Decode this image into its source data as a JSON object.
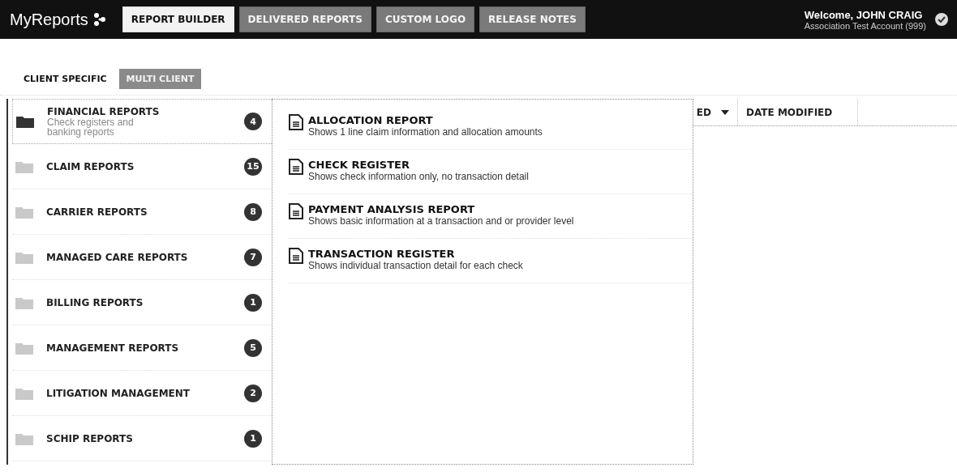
{
  "header": {
    "logo": "MyReports",
    "welcome": "Welcome, JOHN CRAIG",
    "account": "Association Test Account (999)",
    "tabs": [
      {
        "label": "REPORT BUILDER",
        "selected": true
      },
      {
        "label": "DELIVERED REPORTS",
        "selected": false
      },
      {
        "label": "CUSTOM LOGO",
        "selected": false
      },
      {
        "label": "RELEASE NOTES",
        "selected": false
      }
    ]
  },
  "subtabs": [
    {
      "label": "CLIENT SPECIFIC",
      "selected": true
    },
    {
      "label": "MULTI CLIENT",
      "selected": false
    }
  ],
  "table": {
    "columns": [
      "ED",
      "DATE MODIFIED"
    ]
  },
  "categories": [
    {
      "name": "FINANCIAL REPORTS",
      "description": "Check registers and banking reports",
      "count": "4",
      "selected": true
    },
    {
      "name": "CLAIM REPORTS",
      "count": "15",
      "selected": false
    },
    {
      "name": "CARRIER REPORTS",
      "count": "8",
      "selected": false
    },
    {
      "name": "MANAGED CARE REPORTS",
      "count": "7",
      "selected": false
    },
    {
      "name": "BILLING REPORTS",
      "count": "1",
      "selected": false
    },
    {
      "name": "MANAGEMENT REPORTS",
      "count": "5",
      "selected": false
    },
    {
      "name": "LITIGATION MANAGEMENT",
      "count": "2",
      "selected": false
    },
    {
      "name": "SCHIP REPORTS",
      "count": "1",
      "selected": false
    }
  ],
  "reports": [
    {
      "title": "ALLOCATION REPORT",
      "description": "Shows 1 line claim information and allocation amounts"
    },
    {
      "title": "CHECK REGISTER",
      "description": "Shows check information only, no transaction detail"
    },
    {
      "title": "PAYMENT ANALYSIS REPORT",
      "description": "Shows basic information at a transaction and or provider level"
    },
    {
      "title": "TRANSACTION REGISTER",
      "description": "Shows individual transaction detail for each check"
    }
  ]
}
